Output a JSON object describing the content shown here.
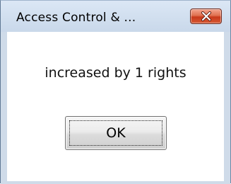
{
  "dialog": {
    "title": "Access Control & ...",
    "message": "increased by 1 rights",
    "ok_label": "OK",
    "close_icon": "close-icon"
  },
  "colors": {
    "frame": "#cfdbe9",
    "close_button": "#d65a34",
    "client_background": "#ffffff"
  }
}
